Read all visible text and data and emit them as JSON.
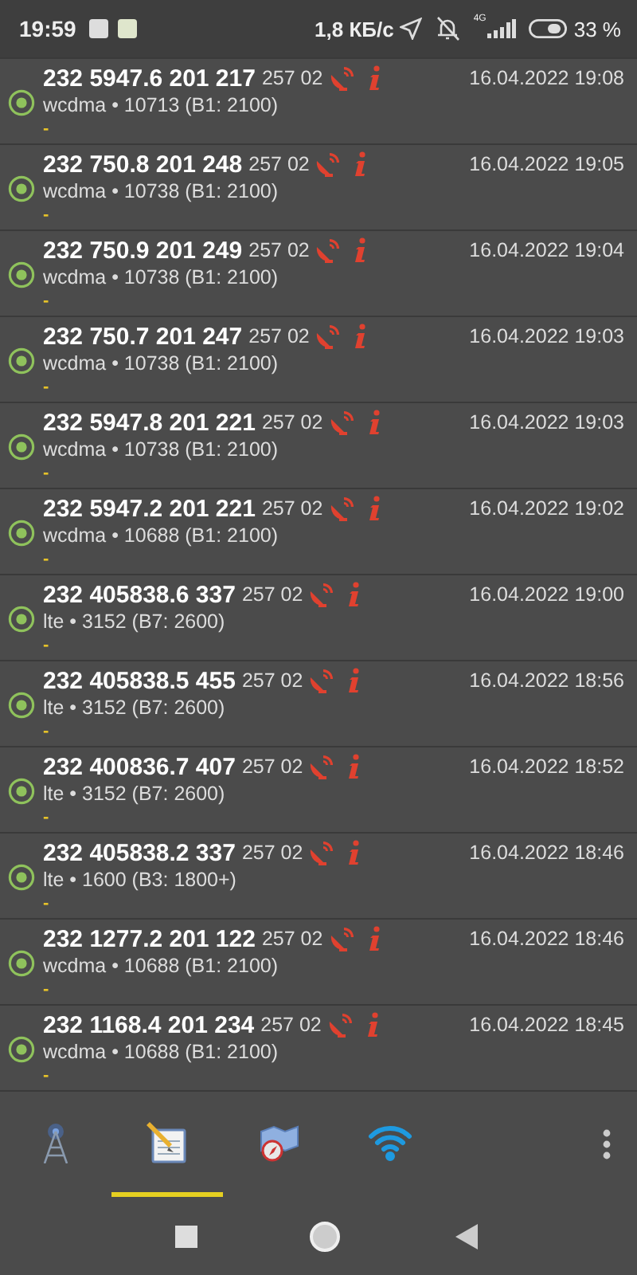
{
  "status_bar": {
    "time": "19:59",
    "speed": "1,8 КБ/с",
    "network": "4G",
    "battery": "33 %"
  },
  "log": [
    {
      "cell": "232 5947.6 201 217",
      "operator": "257 02",
      "date": "16.04.2022 19:08",
      "tech": "wcdma • 10713 (B1: 2100)",
      "note": "-"
    },
    {
      "cell": "232 750.8 201 248",
      "operator": "257 02",
      "date": "16.04.2022 19:05",
      "tech": "wcdma • 10738 (B1: 2100)",
      "note": "-"
    },
    {
      "cell": "232 750.9 201 249",
      "operator": "257 02",
      "date": "16.04.2022 19:04",
      "tech": "wcdma • 10738 (B1: 2100)",
      "note": "-"
    },
    {
      "cell": "232 750.7 201 247",
      "operator": "257 02",
      "date": "16.04.2022 19:03",
      "tech": "wcdma • 10738 (B1: 2100)",
      "note": "-"
    },
    {
      "cell": "232 5947.8 201 221",
      "operator": "257 02",
      "date": "16.04.2022 19:03",
      "tech": "wcdma • 10738 (B1: 2100)",
      "note": "-"
    },
    {
      "cell": "232 5947.2 201 221",
      "operator": "257 02",
      "date": "16.04.2022 19:02",
      "tech": "wcdma • 10688 (B1: 2100)",
      "note": "-"
    },
    {
      "cell": "232 405838.6 337",
      "operator": "257 02",
      "date": "16.04.2022 19:00",
      "tech": "lte • 3152 (B7: 2600)",
      "note": "-"
    },
    {
      "cell": "232 405838.5 455",
      "operator": "257 02",
      "date": "16.04.2022 18:56",
      "tech": "lte • 3152 (B7: 2600)",
      "note": "-"
    },
    {
      "cell": "232 400836.7 407",
      "operator": "257 02",
      "date": "16.04.2022 18:52",
      "tech": "lte • 3152 (B7: 2600)",
      "note": "-"
    },
    {
      "cell": "232 405838.2 337",
      "operator": "257 02",
      "date": "16.04.2022 18:46",
      "tech": "lte • 1600 (B3: 1800+)",
      "note": "-"
    },
    {
      "cell": "232 1277.2 201 122",
      "operator": "257 02",
      "date": "16.04.2022 18:46",
      "tech": "wcdma • 10688 (B1: 2100)",
      "note": "-"
    },
    {
      "cell": "232 1168.4 201 234",
      "operator": "257 02",
      "date": "16.04.2022 18:45",
      "tech": "wcdma • 10688 (B1: 2100)",
      "note": "-"
    }
  ],
  "tabs": [
    {
      "kind": "tower",
      "selected": false
    },
    {
      "kind": "notepad",
      "selected": true
    },
    {
      "kind": "map",
      "selected": false
    },
    {
      "kind": "wifi",
      "selected": false
    }
  ]
}
